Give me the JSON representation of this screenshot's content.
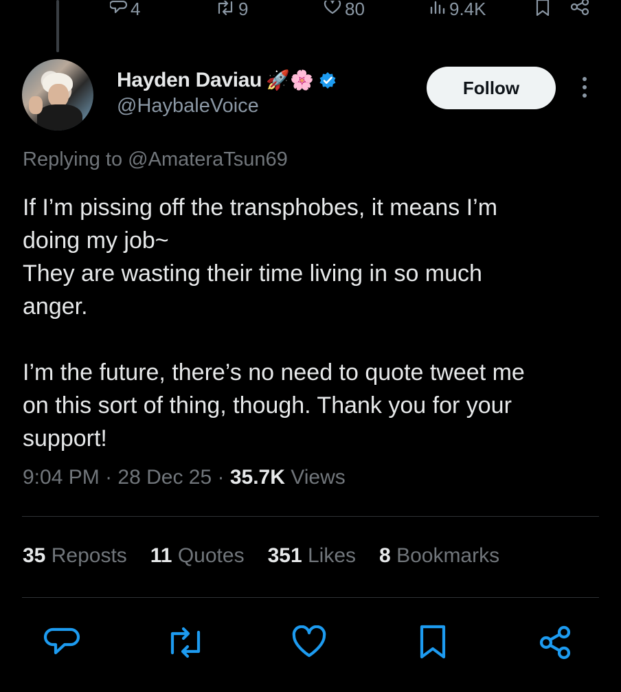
{
  "previous_tweet_actions": {
    "replies": "4",
    "reposts": "9",
    "likes": "80",
    "views": "9.4K"
  },
  "author": {
    "name": "Hayden Daviau",
    "name_emojis": "🚀🌸",
    "handle": "@HaybaleVoice",
    "verified": true,
    "verified_color": "#1d9bf0"
  },
  "follow_button": {
    "label": "Follow"
  },
  "replying_to": {
    "prefix": "Replying to ",
    "mention": "@AmateraTsun69"
  },
  "tweet": {
    "text": "If I’m pissing off the transphobes, it means I’m\ndoing my job~\nThey are wasting their time living in so much\nanger.\n\nI’m the future, there’s no need to quote tweet me\non this sort of thing, though. Thank you for your\nsupport!",
    "time": "9:04 PM",
    "date": "28 Dec 25",
    "views_count": "35.7K",
    "views_label": "Views"
  },
  "stats": {
    "reposts_count": "35",
    "reposts_label": "Reposts",
    "quotes_count": "11",
    "quotes_label": "Quotes",
    "likes_count": "351",
    "likes_label": "Likes",
    "bookmarks_count": "8",
    "bookmarks_label": "Bookmarks"
  },
  "icons": {
    "top_bar": [
      "reply-icon",
      "repost-icon",
      "like-icon",
      "views-icon",
      "bookmark-icon",
      "share-icon"
    ],
    "bottom_bar": [
      "reply-icon",
      "repost-icon",
      "like-icon",
      "bookmark-icon",
      "share-icon"
    ]
  },
  "colors": {
    "background": "#000000",
    "text": "#e7e9ea",
    "muted": "#71767b",
    "follow_bg": "#eff3f4",
    "accent": "#1d9bf0"
  }
}
